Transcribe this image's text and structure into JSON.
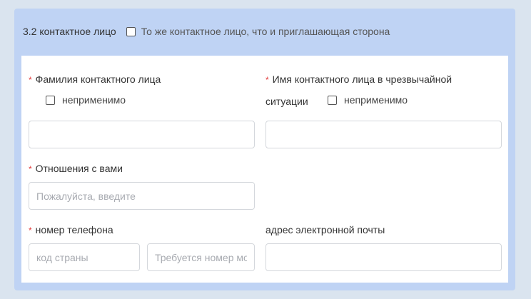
{
  "section": {
    "title": "3.2 контактное лицо",
    "same_as_inviting_label": "То же контактное лицо, что и приглашающая сторона"
  },
  "fields": {
    "surname": {
      "required_mark": "*",
      "label": "Фамилия контактного лица",
      "not_applicable_label": "неприменимо",
      "value": ""
    },
    "emergency_name": {
      "required_mark": "*",
      "label_line1": "Имя контактного лица в чрезвычайной",
      "label_line2": "ситуации",
      "not_applicable_label": "неприменимо",
      "value": ""
    },
    "relationship": {
      "required_mark": "*",
      "label": "Отношения с вами",
      "placeholder": "Пожалуйста, введите"
    },
    "phone": {
      "required_mark": "*",
      "label": "номер телефона",
      "country_code_placeholder": "код страны",
      "number_placeholder": "Требуется номер мобильного телефона"
    },
    "email": {
      "label": "адрес электронной почты",
      "value": ""
    }
  }
}
